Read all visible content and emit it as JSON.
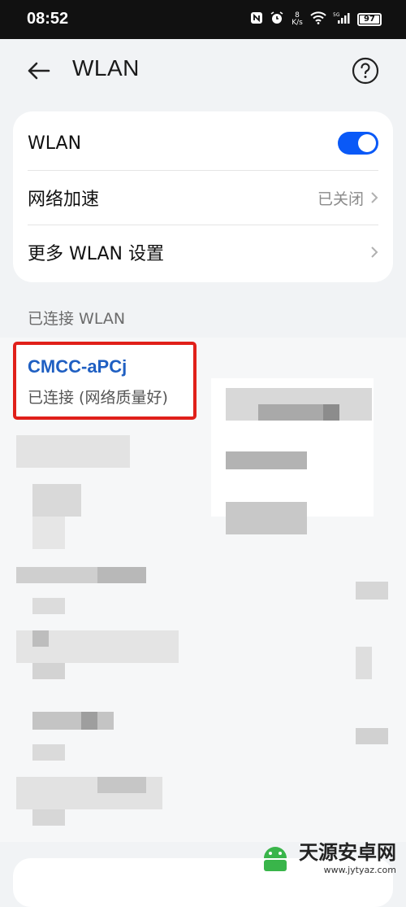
{
  "status_bar": {
    "time": "08:52",
    "net_speed_value": "8",
    "net_speed_unit": "K/s",
    "signal_label": "5G",
    "battery": "97"
  },
  "header": {
    "title": "WLAN",
    "back_icon": "back-arrow-icon",
    "help_icon": "help-circle-icon"
  },
  "settings": {
    "wlan_label": "WLAN",
    "wlan_enabled": true,
    "accel_label": "网络加速",
    "accel_value": "已关闭",
    "more_label": "更多 WLAN 设置"
  },
  "connected_section": {
    "title": "已连接 WLAN",
    "ssid": "CMCC-aPCj",
    "status": "已连接 (网络质量好)"
  },
  "watermark": {
    "text": "天源安卓网",
    "url": "www.jytyaz.com"
  },
  "colors": {
    "accent": "#0a59f7",
    "highlight_border": "#e0201a",
    "ssid": "#1f5fc2"
  }
}
